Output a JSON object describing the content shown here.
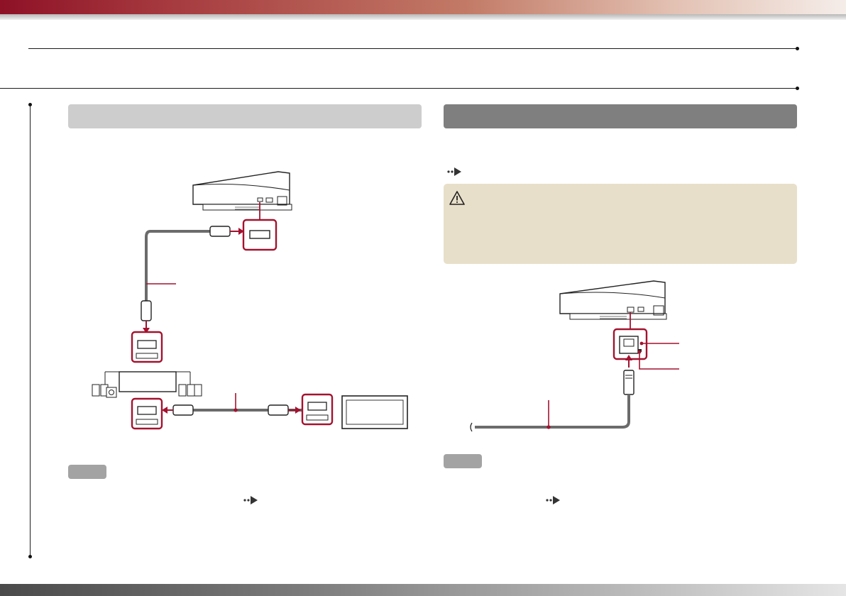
{
  "page": {
    "header_title": "",
    "section_title": ""
  },
  "left_section": {
    "title": "",
    "intro": "",
    "note_label": "",
    "note_text": ""
  },
  "right_section": {
    "title": "",
    "intro": "",
    "ref_text": "",
    "caution": {
      "title": "",
      "text": ""
    },
    "note_label": "",
    "note_text": ""
  },
  "diagram_labels": {
    "hdmi_cable_1": "",
    "hdmi_cable_2": "",
    "lan_connector": "",
    "access_indicator": "",
    "ethernet_cable": ""
  },
  "colors": {
    "accent_red": "#a3122f",
    "cable_gray": "#6b6b6b",
    "header_light": "#cdcdcd",
    "header_dark": "#7f7f7f",
    "caution_bg": "#e8dfca"
  }
}
